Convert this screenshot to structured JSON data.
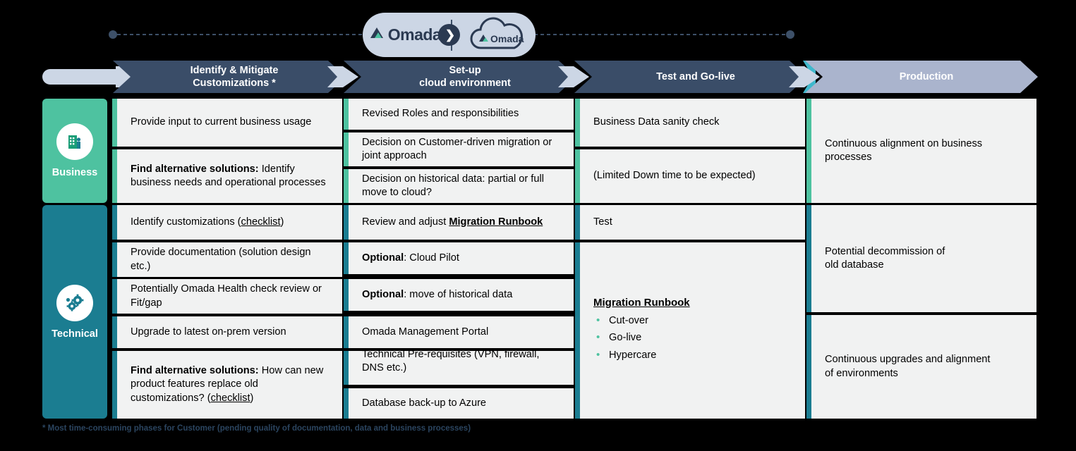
{
  "banner": {
    "brand_name": "Omada",
    "cloud_brand_name": "Omada",
    "arrow_glyph": "❯",
    "onprem_logo_icon": "omada-logo-icon",
    "cloud_logo_icon": "omada-cloud-logo-icon",
    "transition_icon": "arrow-right-circle-icon"
  },
  "phases": [
    {
      "id": "identify",
      "line1": "Identify & Mitigate",
      "line2": "Customizations *",
      "style": "dark"
    },
    {
      "id": "setup",
      "line1": "Set-up",
      "line2": "cloud environment",
      "style": "dark"
    },
    {
      "id": "test",
      "line1": "Test and Go-live",
      "line2": "",
      "style": "dark"
    },
    {
      "id": "production",
      "line1": "Production",
      "line2": "",
      "style": "light"
    }
  ],
  "categories": [
    {
      "id": "business",
      "label": "Business",
      "icon": "building-icon",
      "color": "#4ec2a0"
    },
    {
      "id": "technical",
      "label": "Technical",
      "icon": "gears-icon",
      "color": "#1b7d91"
    }
  ],
  "cells": {
    "c1r1": "Provide input to current business usage",
    "c1r2_bold": "Find alternative solutions:",
    "c1r2_rest": " Identify business needs and operational processes",
    "c1r3_pre": "Identify customizations (",
    "c1r3_link": "checklist",
    "c1r3_post": ")",
    "c1r4": "Provide documentation (solution design etc.)",
    "c1r5": "Potentially Omada Health check review or Fit/gap",
    "c1r6": "Upgrade to latest on-prem version",
    "c1r7_bold": "Find alternative solutions:",
    "c1r7_mid": " How can new product features replace old customizations? (",
    "c1r7_link": "checklist",
    "c1r7_post": ")",
    "c2r1": "Revised Roles and responsibilities",
    "c2r2": "Decision on Customer-driven migration or joint approach",
    "c2r3": "Decision on historical data: partial or full move to cloud?",
    "c2r4_pre": "Review and adjust ",
    "c2r4_link": "Migration Runbook",
    "c2r5_bold": "Optional",
    "c2r5_rest": ": Cloud Pilot",
    "c2r6_bold": "Optional",
    "c2r6_rest": ": move of historical data",
    "c2r7": "Omada Management Portal",
    "c2r8": "Technical Pre-requisites (VPN, firewall,\nDNS etc.)",
    "c2r9": "Database back-up to Azure",
    "c3r1": "Business Data sanity check",
    "c3r2": "(Limited Down time to be expected)",
    "c3r3": "Test",
    "c3r4_title": "Migration Runbook",
    "c3r4_bullets": [
      "Cut-over",
      "Go-live",
      "Hypercare"
    ],
    "c4r1": "Continuous alignment on business processes",
    "c4r2": "Potential decommission of\nold database",
    "c4r3": "Continuous upgrades and alignment\nof environments"
  },
  "footnote": "* Most time-consuming phases for Customer (pending quality of documentation, data and business processes)"
}
